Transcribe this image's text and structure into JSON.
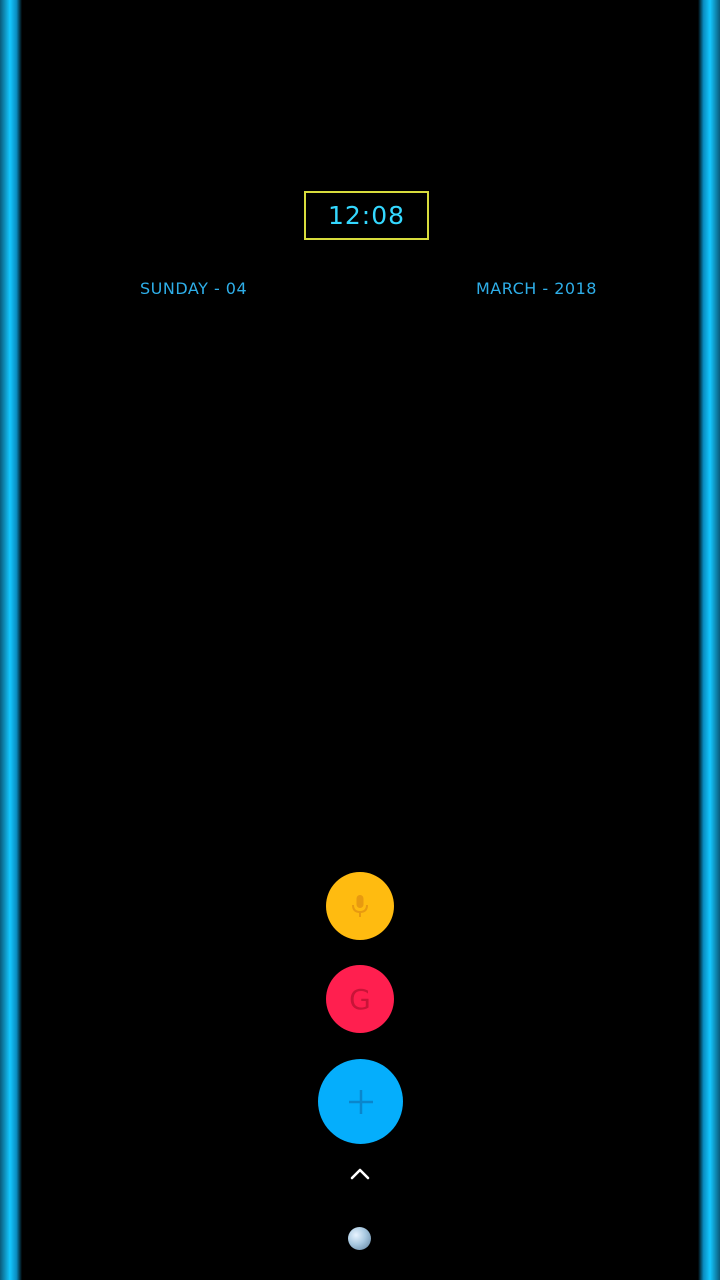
{
  "clock": {
    "time": "12:08"
  },
  "date": {
    "day": "SUNDAY - 04",
    "month_year": "MARCH - 2018"
  },
  "fabs": {
    "mic": {
      "icon": "microphone-icon",
      "color": "#ffbb10"
    },
    "google": {
      "label": "G",
      "icon": "google-icon",
      "color": "#ff1f4f"
    },
    "add": {
      "icon": "plus-icon",
      "color": "#05aefc"
    }
  },
  "drawer": {
    "icon": "chevron-up-icon"
  },
  "colors": {
    "edge_glow": "#14c8ff",
    "clock_border": "#d8dc3c",
    "clock_text": "#34d8ff",
    "date_text": "#2eaee8",
    "background": "#000000"
  }
}
